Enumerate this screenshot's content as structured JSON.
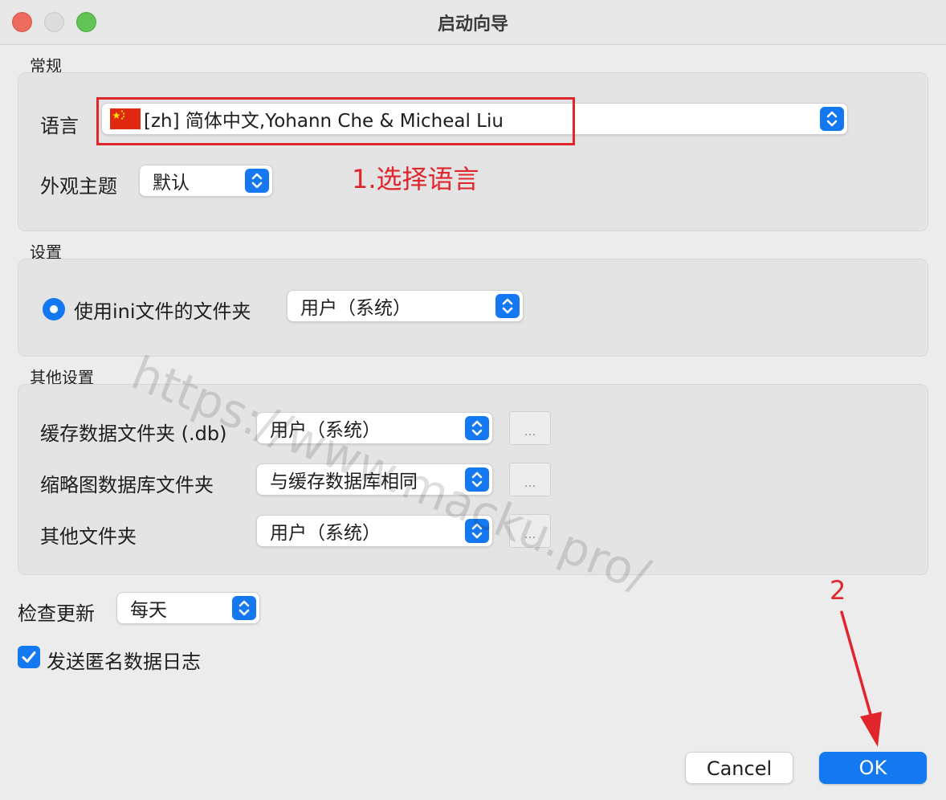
{
  "window": {
    "title": "启动向导"
  },
  "general": {
    "label": "常规",
    "language_label": "语言",
    "language_value": "[zh] 简体中文,Yohann Che & Micheal Liu",
    "theme_label": "外观主题",
    "theme_value": "默认"
  },
  "settings": {
    "label": "设置",
    "ini_radio_label": "使用ini文件的文件夹",
    "ini_value": "用户（系统）"
  },
  "other": {
    "label": "其他设置",
    "rows": [
      {
        "label": "缓存数据文件夹 (.db)",
        "value": "用户（系统）",
        "browse": "..."
      },
      {
        "label": "缩略图数据库文件夹",
        "value": "与缓存数据库相同",
        "browse": "..."
      },
      {
        "label": "其他文件夹",
        "value": "用户（系统）",
        "browse": "..."
      }
    ]
  },
  "update": {
    "label": "检查更新",
    "value": "每天"
  },
  "anon_log": {
    "label": "发送匿名数据日志",
    "checked": true
  },
  "buttons": {
    "cancel": "Cancel",
    "ok": "OK"
  },
  "annotations": {
    "step1": "1.选择语言",
    "step2": "2",
    "color": "#e0262c"
  },
  "watermark": "https://www.macku.pro/",
  "colors": {
    "accent": "#1479f1",
    "background": "#ececec"
  }
}
